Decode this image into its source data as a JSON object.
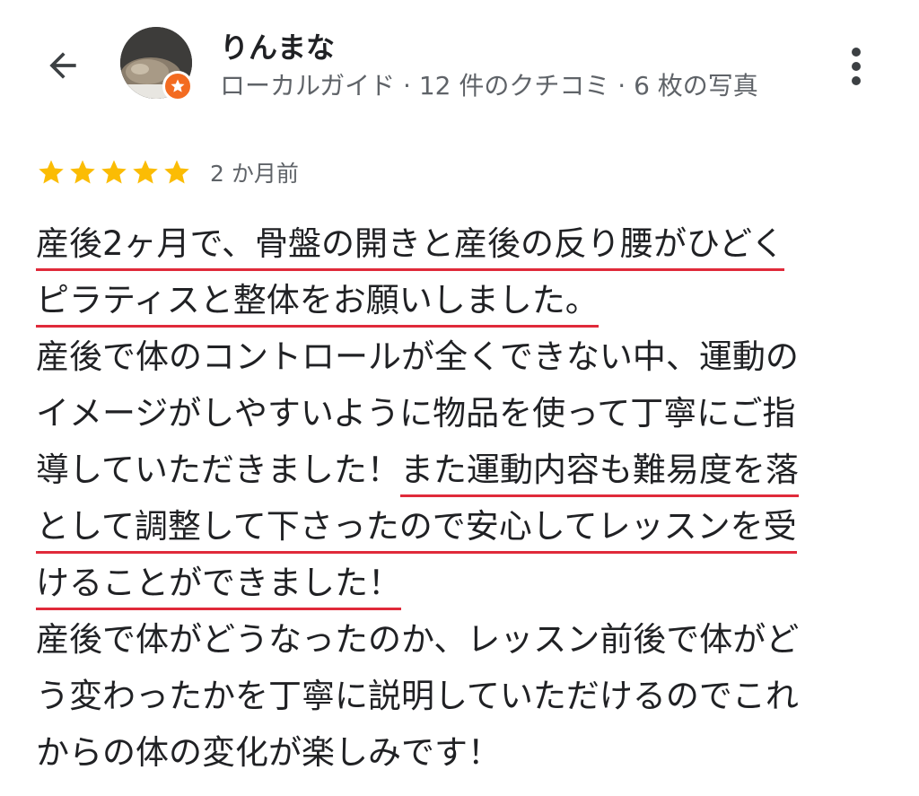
{
  "header": {
    "back_icon": "arrow-back-icon",
    "reviewer_name": "りんまな",
    "reviewer_meta": "ローカルガイド · 12 件のクチコミ · 6 枚の写真",
    "badge_icon": "local-guide-star-icon",
    "more_icon": "more-vert-icon"
  },
  "review": {
    "rating": 5,
    "rating_max": 5,
    "date": "2 か月前",
    "star_color": "#fbbc04",
    "highlight_color": "#e02a3a",
    "lines": [
      "産後2ヶ月で、骨盤の開きと産後の反り腰がひどく",
      "ピラティスと整体をお願いしました。",
      "産後で体のコントロールが全くできない中、運動の",
      "イメージがしやすいように物品を使って丁寧にご指",
      "導していただきました！",
      "また運動内容も難易度を落",
      "として調整して下さったので安心してレッスンを受",
      "けることができました！",
      "産後で体がどうなったのか、レッスン前後で体がど",
      "う変わったかを丁寧に説明していただけるのでこれ",
      "からの体の変化が楽しみです！"
    ]
  }
}
